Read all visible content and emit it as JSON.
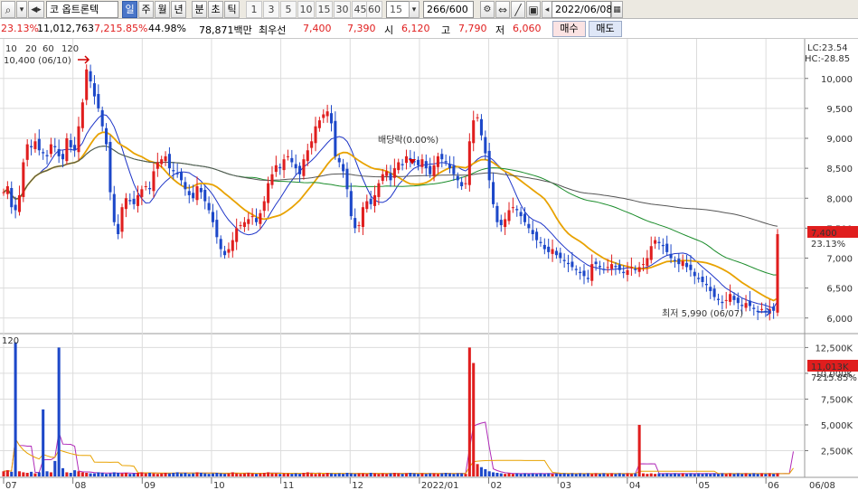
{
  "toolbar": {
    "market_prefix": "코",
    "stock_name": "옵트론텍",
    "period_tabs": [
      "일",
      "주",
      "월",
      "년",
      "분",
      "초",
      "틱"
    ],
    "active_tab": "일",
    "interval_buttons": [
      "1",
      "3",
      "5",
      "10",
      "15",
      "30",
      "45",
      "60"
    ],
    "interval_value": "15",
    "count_value": "266/600",
    "date_value": "2022/06/08"
  },
  "quote": {
    "change_pct": "23.13%",
    "volume": "11,012,763",
    "volume_ratio": "7,215.85%",
    "turnover": "44.98%",
    "amount": "78,871백만",
    "best_ask_label": "최우선",
    "best_ask": "7,400",
    "best_bid": "7,390",
    "open_label": "시",
    "open": "6,120",
    "high_label": "고",
    "high": "7,790",
    "low_label": "저",
    "low": "6,060",
    "buy_button": "매수",
    "sell_button": "매도"
  },
  "chart_data": {
    "type": "candlestick",
    "ma_legend": [
      {
        "label": "10",
        "color": "#1e35c8"
      },
      {
        "label": "20",
        "color": "#e8a200"
      },
      {
        "label": "60",
        "color": "#1a8c2a"
      },
      {
        "label": "120",
        "color": "#555555"
      }
    ],
    "lc_label": "LC:23.54",
    "hc_label": "HC:-28.85",
    "price_axis": [
      "10,000",
      "9,500",
      "9,000",
      "8,500",
      "8,000",
      "7,500",
      "7,000",
      "6,500",
      "6,000"
    ],
    "ylim": [
      5800,
      10600
    ],
    "high_annotation": "10,400 (06/10)",
    "low_annotation": "최저 5,990 (06/07)",
    "dividend_annotation": "배당락(0.00%)",
    "current_price_tag": "7,400",
    "current_pct_tag": "23.13%",
    "volume_legend": "120",
    "volume_axis": [
      "12,500K",
      "10,000K",
      "7,500K",
      "5,000K",
      "2,500K"
    ],
    "volume_ylim": [
      0,
      13500
    ],
    "current_volume_tag": "11,013K",
    "current_volume_pct_tag": "7215.85%",
    "date_axis": [
      "07",
      "08",
      "09",
      "10",
      "11",
      "12",
      "2022/01",
      "02",
      "03",
      "04",
      "05",
      "06",
      "06/08"
    ],
    "closes": [
      8100,
      8200,
      7850,
      7800,
      8050,
      8600,
      8900,
      8850,
      8950,
      8800,
      8750,
      8700,
      8900,
      8850,
      8700,
      8650,
      9000,
      8850,
      8800,
      9200,
      9600,
      10150,
      9950,
      9700,
      9500,
      9200,
      8900,
      8100,
      7600,
      7400,
      7850,
      8000,
      7950,
      7900,
      8050,
      8150,
      8200,
      8150,
      8450,
      8600,
      8650,
      8700,
      8500,
      8450,
      8400,
      8300,
      8150,
      8050,
      8000,
      8200,
      8100,
      7950,
      7800,
      7600,
      7350,
      7150,
      7050,
      7150,
      7300,
      7500,
      7550,
      7600,
      7650,
      7700,
      7600,
      7750,
      7950,
      8250,
      8400,
      8550,
      8500,
      8650,
      8700,
      8600,
      8500,
      8400,
      8650,
      8800,
      8950,
      9200,
      9300,
      9400,
      9450,
      9250,
      8700,
      8600,
      8450,
      8150,
      7700,
      7500,
      7550,
      7850,
      7950,
      7900,
      8050,
      8250,
      8400,
      8450,
      8300,
      8500,
      8600,
      8550,
      8700,
      8650,
      8600,
      8550,
      8650,
      8500,
      8400,
      8550,
      8700,
      8650,
      8600,
      8500,
      8400,
      8300,
      8200,
      8250,
      8950,
      9300,
      9350,
      9050,
      8750,
      8300,
      7900,
      7600,
      7550,
      7650,
      7800,
      7850,
      7800,
      7700,
      7600,
      7500,
      7400,
      7300,
      7250,
      7150,
      7100,
      7150,
      7050,
      7000,
      6950,
      6900,
      6850,
      6800,
      6750,
      6700,
      6650,
      6900,
      6900,
      6850,
      6800,
      6850,
      6900,
      6850,
      6800,
      6750,
      6800,
      6850,
      6800,
      6850,
      6900,
      7000,
      7200,
      7300,
      7250,
      7200,
      7100,
      7000,
      6950,
      6900,
      6950,
      6850,
      6800,
      6700,
      6650,
      6600,
      6550,
      6450,
      6350,
      6300,
      6250,
      6300,
      6400,
      6300,
      6250,
      6200,
      6250,
      6200,
      6150,
      6100,
      6150,
      6100,
      6150,
      6120,
      7400
    ],
    "volumes": [
      500,
      600,
      450,
      13000,
      500,
      400,
      350,
      450,
      300,
      400,
      6500,
      500,
      400,
      1500,
      12500,
      800,
      400,
      350,
      600,
      500,
      400,
      350,
      300,
      300,
      400,
      350,
      250,
      300,
      400,
      350,
      300,
      350,
      250,
      300,
      350,
      400,
      300,
      350,
      300,
      250,
      300,
      350,
      300,
      350,
      400,
      300,
      350,
      250,
      300,
      400,
      350,
      300,
      250,
      300,
      350,
      300,
      250,
      300,
      400,
      300,
      250,
      300,
      350,
      300,
      250,
      300,
      350,
      400,
      300,
      300,
      250,
      300,
      300,
      250,
      300,
      250,
      350,
      400,
      300,
      250,
      300,
      250,
      350,
      300,
      250,
      300,
      250,
      350,
      300,
      250,
      300,
      300,
      250,
      350,
      300,
      250,
      300,
      250,
      300,
      350,
      300,
      250,
      300,
      350,
      300,
      250,
      300,
      250,
      300,
      300,
      250,
      300,
      350,
      300,
      250,
      300,
      300,
      250,
      12500,
      11000,
      1200,
      900,
      700,
      500,
      400,
      350,
      300,
      250,
      300,
      250,
      300,
      250,
      300,
      250,
      300,
      250,
      300,
      250,
      300,
      250,
      300,
      250,
      300,
      250,
      300,
      250,
      300,
      250,
      300,
      250,
      300,
      250,
      300,
      250,
      300,
      250,
      300,
      250,
      300,
      250,
      300,
      5000,
      300,
      250,
      300,
      250,
      300,
      250,
      300,
      250,
      300,
      250,
      300,
      250,
      300,
      250,
      300,
      250,
      300,
      250,
      300,
      250,
      300,
      250,
      300,
      250,
      300,
      250,
      300,
      250,
      300,
      250,
      300,
      250,
      300,
      250,
      300,
      250,
      300,
      250,
      11013
    ]
  }
}
